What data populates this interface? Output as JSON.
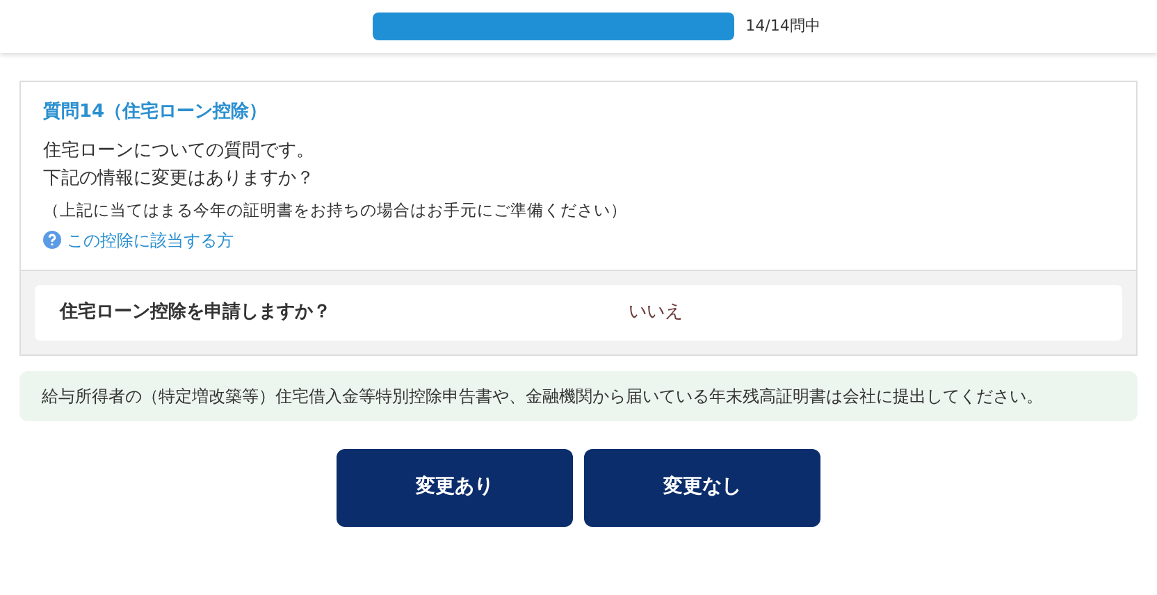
{
  "progress": {
    "level": 1.0,
    "label": "14/14問中"
  },
  "question": {
    "title": "質問14（住宅ローン控除）",
    "lines": [
      "住宅ローンについての質問です。",
      "下記の情報に変更はありますか？"
    ],
    "note": "（上記に当てはまる今年の証明書をお持ちの場合はお手元にご準備ください）",
    "help_link": "この控除に該当する方"
  },
  "answers": [
    {
      "label": "住宅ローン控除を申請しますか？",
      "value": "いいえ"
    }
  ],
  "info": "給与所得者の（特定増改築等）住宅借入金等特別控除申告書や、金融機関から届いている年末残高証明書は会社に提出してください。",
  "buttons": [
    "変更あり",
    "変更なし"
  ]
}
